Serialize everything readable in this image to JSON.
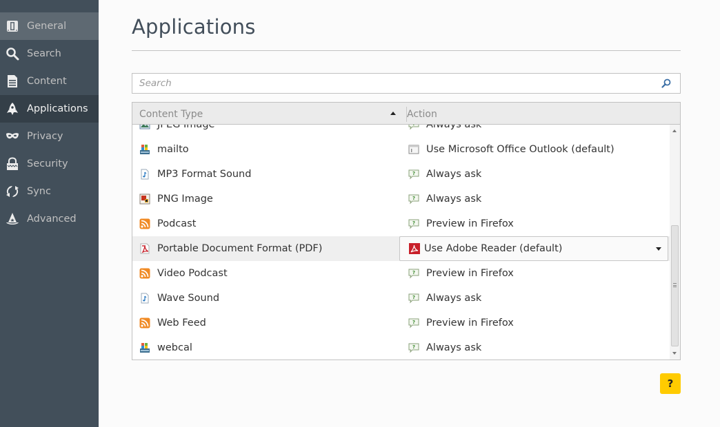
{
  "sidebar": {
    "items": [
      {
        "label": "General",
        "icon": "general-icon",
        "state": "hover"
      },
      {
        "label": "Search",
        "icon": "search-icon",
        "state": ""
      },
      {
        "label": "Content",
        "icon": "content-icon",
        "state": ""
      },
      {
        "label": "Applications",
        "icon": "applications-icon",
        "state": "active"
      },
      {
        "label": "Privacy",
        "icon": "privacy-icon",
        "state": ""
      },
      {
        "label": "Security",
        "icon": "security-icon",
        "state": ""
      },
      {
        "label": "Sync",
        "icon": "sync-icon",
        "state": ""
      },
      {
        "label": "Advanced",
        "icon": "advanced-icon",
        "state": ""
      }
    ]
  },
  "header": {
    "title": "Applications"
  },
  "search": {
    "placeholder": "Search",
    "value": ""
  },
  "table": {
    "columns": {
      "content_type": "Content Type",
      "action": "Action"
    },
    "sort": "ascending",
    "rows": [
      {
        "type": "JPEG Image",
        "type_icon": "image-icon",
        "action": "Always ask",
        "action_icon": "always-ask-icon"
      },
      {
        "type": "mailto",
        "type_icon": "windows-app-icon",
        "action": "Use Microsoft Office Outlook (default)",
        "action_icon": "application-icon"
      },
      {
        "type": "MP3 Format Sound",
        "type_icon": "audio-file-icon",
        "action": "Always ask",
        "action_icon": "always-ask-icon"
      },
      {
        "type": "PNG Image",
        "type_icon": "png-image-icon",
        "action": "Always ask",
        "action_icon": "always-ask-icon"
      },
      {
        "type": "Podcast",
        "type_icon": "rss-feed-icon",
        "action": "Preview in Firefox",
        "action_icon": "always-ask-icon"
      },
      {
        "type": "Portable Document Format (PDF)",
        "type_icon": "pdf-icon",
        "action": "Use Adobe Reader  (default)",
        "action_icon": "adobe-reader-icon",
        "selected": true
      },
      {
        "type": "Video Podcast",
        "type_icon": "rss-feed-icon",
        "action": "Preview in Firefox",
        "action_icon": "always-ask-icon"
      },
      {
        "type": "Wave Sound",
        "type_icon": "audio-file-icon",
        "action": "Always ask",
        "action_icon": "always-ask-icon"
      },
      {
        "type": "Web Feed",
        "type_icon": "rss-feed-icon",
        "action": "Preview in Firefox",
        "action_icon": "always-ask-icon"
      },
      {
        "type": "webcal",
        "type_icon": "windows-app-icon",
        "action": "Always ask",
        "action_icon": "always-ask-icon"
      }
    ]
  },
  "help": {
    "label": "?"
  },
  "colors": {
    "sidebar_bg": "#424f5a",
    "sidebar_active": "#343f48",
    "sidebar_hover": "#5e6972",
    "help_button": "#ffcb00",
    "pdf_red": "#c8202a",
    "rss_orange": "#f08a24"
  }
}
